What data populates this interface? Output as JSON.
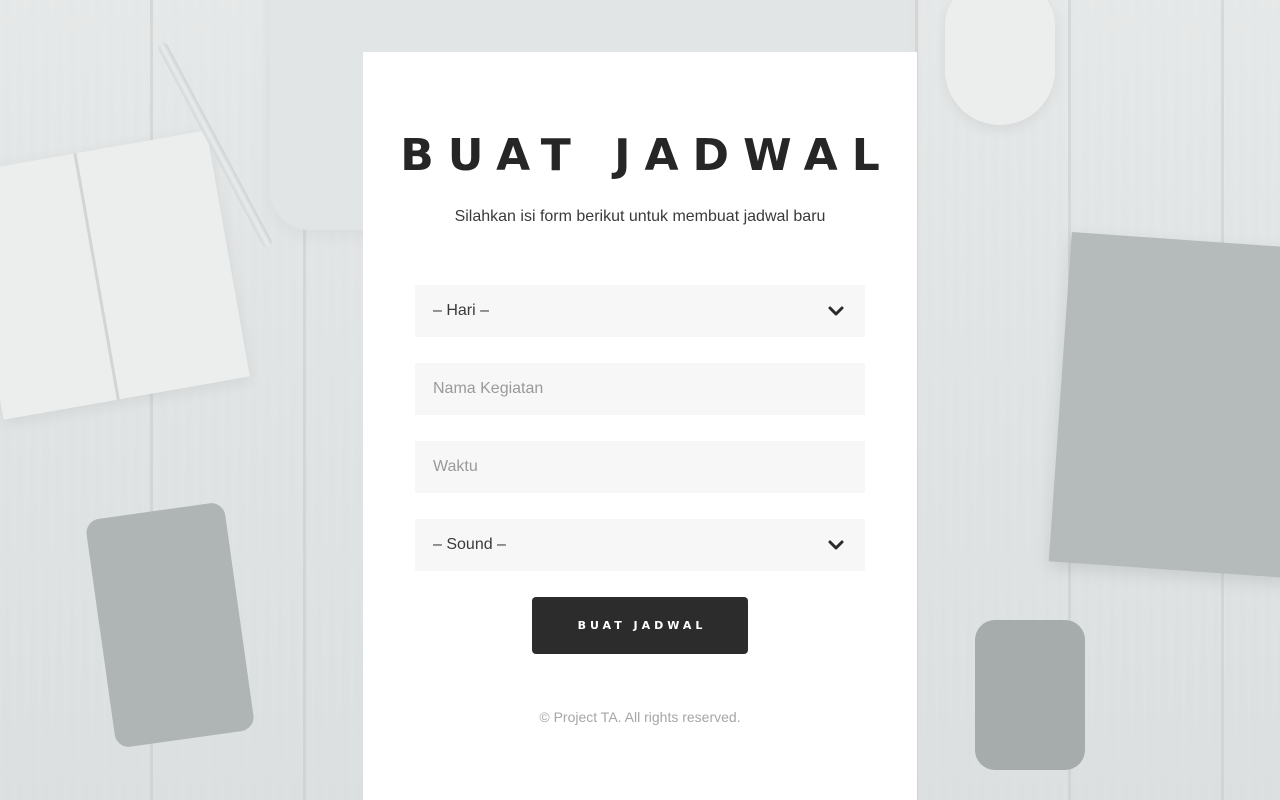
{
  "form": {
    "title": "BUAT JADWAL",
    "subtitle": "Silahkan isi form berikut untuk membuat jadwal baru",
    "hari_select": {
      "value": "– Hari –",
      "icon": "chevron-down-icon"
    },
    "nama_kegiatan": {
      "placeholder": "Nama Kegiatan"
    },
    "waktu": {
      "placeholder": "Waktu"
    },
    "sound_select": {
      "value": "– Sound –",
      "icon": "chevron-down-icon"
    },
    "submit_label": "BUAT JADWAL"
  },
  "footer": {
    "text": "© Project TA. All rights reserved."
  },
  "colors": {
    "card": "#ffffff",
    "field_bg": "#f7f7f7",
    "button": "#2c2c2c",
    "title": "#262626"
  }
}
